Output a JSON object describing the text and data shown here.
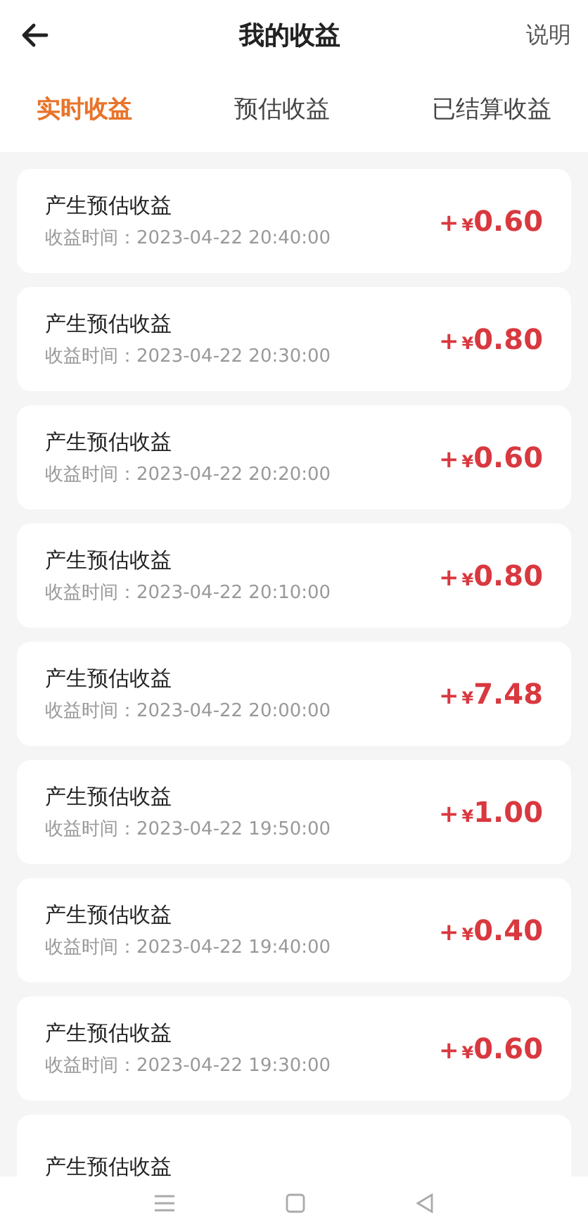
{
  "header": {
    "title": "我的收益",
    "action": "说明"
  },
  "tabs": [
    {
      "label": "实时收益",
      "selected": true
    },
    {
      "label": "预估收益",
      "selected": false
    },
    {
      "label": "已结算收益",
      "selected": false
    }
  ],
  "records": [
    {
      "title": "产生预估收益",
      "time": "收益时间：2023-04-22 20:40:00",
      "sign": "+",
      "currency": "¥",
      "value": "0.60"
    },
    {
      "title": "产生预估收益",
      "time": "收益时间：2023-04-22 20:30:00",
      "sign": "+",
      "currency": "¥",
      "value": "0.80"
    },
    {
      "title": "产生预估收益",
      "time": "收益时间：2023-04-22 20:20:00",
      "sign": "+",
      "currency": "¥",
      "value": "0.60"
    },
    {
      "title": "产生预估收益",
      "time": "收益时间：2023-04-22 20:10:00",
      "sign": "+",
      "currency": "¥",
      "value": "0.80"
    },
    {
      "title": "产生预估收益",
      "time": "收益时间：2023-04-22 20:00:00",
      "sign": "+",
      "currency": "¥",
      "value": "7.48"
    },
    {
      "title": "产生预估收益",
      "time": "收益时间：2023-04-22 19:50:00",
      "sign": "+",
      "currency": "¥",
      "value": "1.00"
    },
    {
      "title": "产生预估收益",
      "time": "收益时间：2023-04-22 19:40:00",
      "sign": "+",
      "currency": "¥",
      "value": "0.40"
    },
    {
      "title": "产生预估收益",
      "time": "收益时间：2023-04-22 19:30:00",
      "sign": "+",
      "currency": "¥",
      "value": "0.60"
    },
    {
      "title": "产生预估收益"
    }
  ]
}
